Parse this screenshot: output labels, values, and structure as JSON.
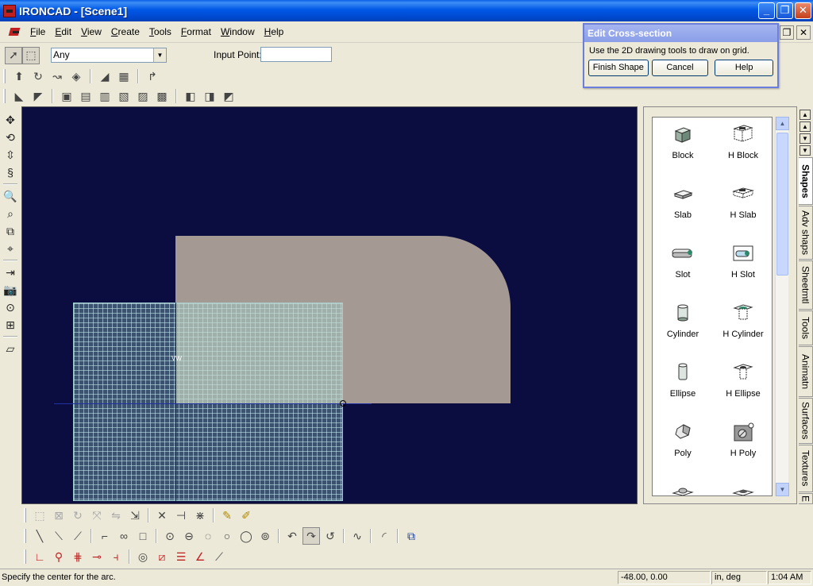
{
  "window": {
    "title": "IRONCAD - [Scene1]",
    "minimize": "_",
    "restore": "❐",
    "close": "✕"
  },
  "menu": {
    "items": [
      "File",
      "Edit",
      "View",
      "Create",
      "Tools",
      "Format",
      "Window",
      "Help"
    ]
  },
  "selection_bar": {
    "filter_value": "Any",
    "input_point_label": "Input Point:",
    "input_point_value": ""
  },
  "dialog": {
    "title": "Edit Cross-section",
    "message": "Use the 2D drawing tools to draw on grid.",
    "finish_label": "Finish Shape",
    "cancel_label": "Cancel",
    "help_label": "Help"
  },
  "catalog": {
    "items": [
      {
        "label": "Block",
        "icon": "block-icon"
      },
      {
        "label": "H Block",
        "icon": "h-block-icon"
      },
      {
        "label": "Slab",
        "icon": "slab-icon"
      },
      {
        "label": "H Slab",
        "icon": "h-slab-icon"
      },
      {
        "label": "Slot",
        "icon": "slot-icon"
      },
      {
        "label": "H Slot",
        "icon": "h-slot-icon"
      },
      {
        "label": "Cylinder",
        "icon": "cylinder-icon"
      },
      {
        "label": "H Cylinder",
        "icon": "h-cylinder-icon"
      },
      {
        "label": "Ellipse",
        "icon": "ellipse-icon"
      },
      {
        "label": "H Ellipse",
        "icon": "h-ellipse-icon"
      },
      {
        "label": "Poly",
        "icon": "poly-icon"
      },
      {
        "label": "H Poly",
        "icon": "h-poly-icon"
      },
      {
        "label": "",
        "icon": "cone-icon"
      },
      {
        "label": "",
        "icon": "h-cone-icon"
      }
    ],
    "tabs": [
      "Shapes",
      "Adv shaps",
      "Sheetmtl",
      "Tools",
      "Animatn",
      "Surfaces",
      "Textures",
      "E"
    ]
  },
  "viewport": {
    "grid_label": "VW"
  },
  "status": {
    "message": "Specify the center for the arc.",
    "coords": "-48.00, 0.00",
    "units": "in, deg",
    "time": "1:04 AM"
  },
  "colors": {
    "viewport_bg": "#0b0c3f",
    "shape": "#a59993",
    "grid": "#78aaaa",
    "titlebar": "#0058e6"
  }
}
